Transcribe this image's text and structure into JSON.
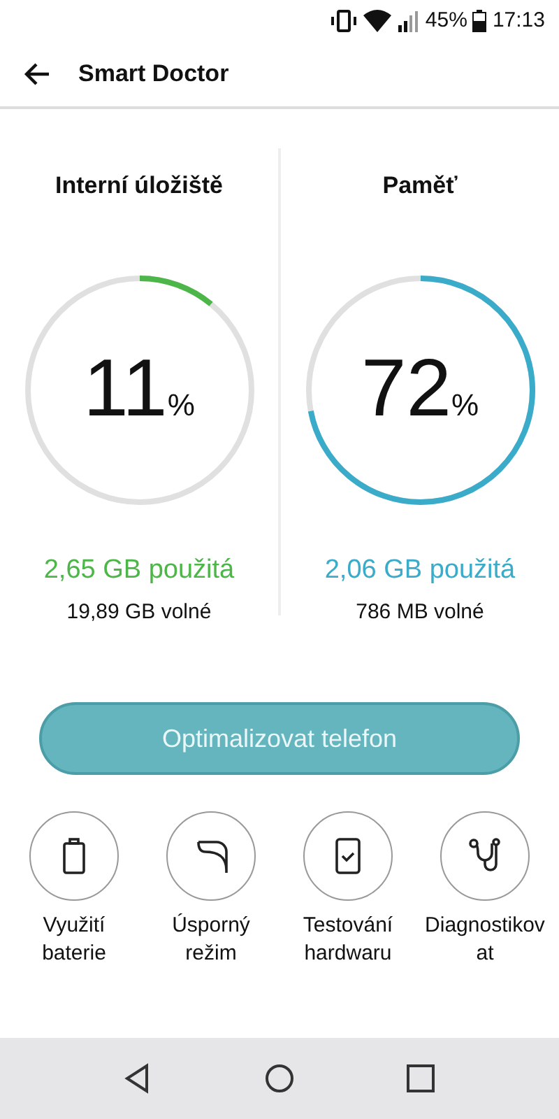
{
  "status_bar": {
    "battery": "45%",
    "time": "17:13"
  },
  "app_bar": {
    "title": "Smart Doctor"
  },
  "gauges": [
    {
      "title": "Interní úložiště",
      "value": "11",
      "unit": "%",
      "level": 0.11,
      "color": "#4cb648",
      "used": "2,65 GB použitá",
      "free": "19,89 GB volné"
    },
    {
      "title": "Paměť",
      "value": "72",
      "unit": "%",
      "level": 0.72,
      "color": "#3aabc9",
      "used": "2,06 GB použitá",
      "free": "786 MB volné"
    }
  ],
  "optimize_button": "Optimalizovat telefon",
  "tools": [
    {
      "kind": "battery",
      "label": "Využití baterie"
    },
    {
      "kind": "leaf",
      "label": "Úsporný režim"
    },
    {
      "kind": "phone-check",
      "label": "Testování hardwaru"
    },
    {
      "kind": "stethoscope",
      "label": "Diagnostikovat"
    }
  ]
}
